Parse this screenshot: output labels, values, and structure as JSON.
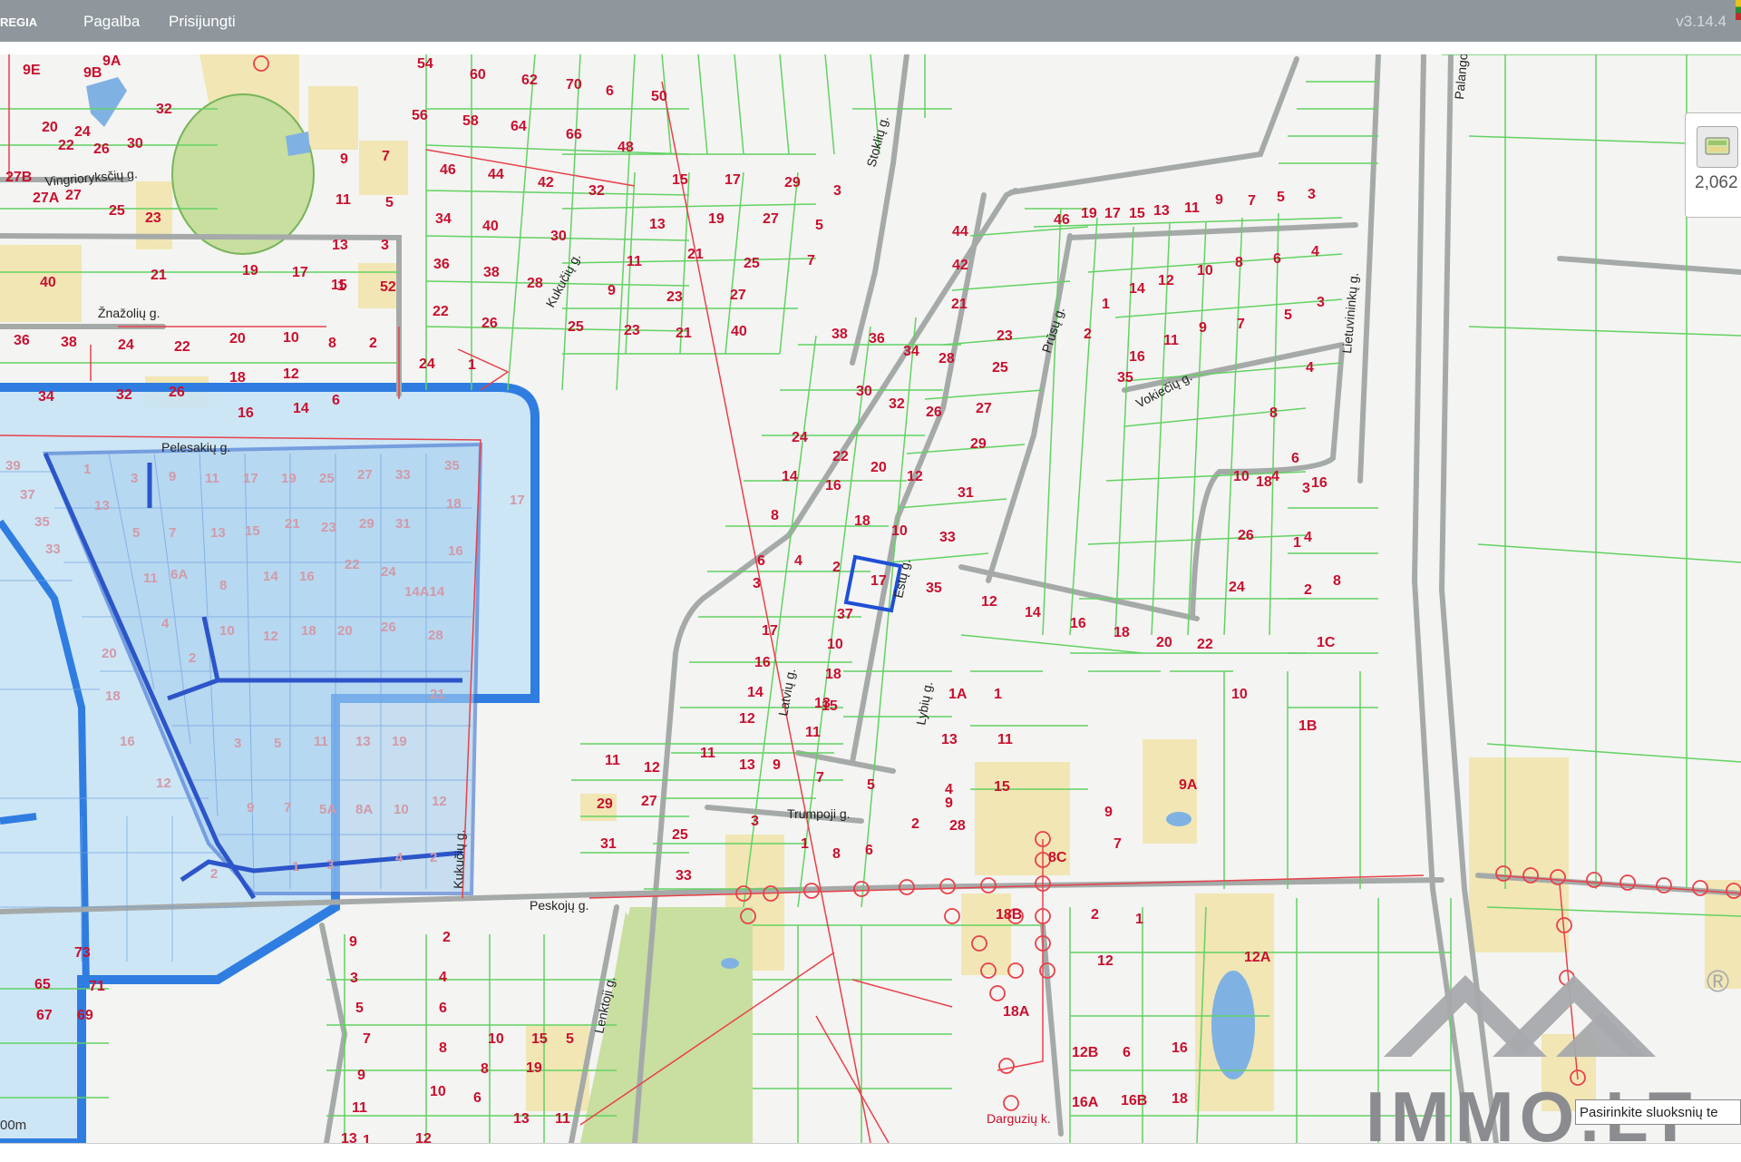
{
  "app": {
    "brand": "REGIA",
    "nav": [
      "Pagalba",
      "Prisijungti"
    ],
    "version": "v3.14.4"
  },
  "widget": {
    "value": "2,062",
    "icon": "layers-icon"
  },
  "scale_label": "00m",
  "tooltip": "Pasirinkite sluoksnių te",
  "watermark": {
    "text": "IMMO.LT",
    "mark": "®"
  },
  "colors": {
    "parcel": "#62d262",
    "number": "#c8102e",
    "road": "#a5aaa9",
    "zone_fill": "#bfe0f7",
    "zone_border": "#2f7de1",
    "highlight": "#1f4fd6",
    "building_fill": "#f2e8b8",
    "forest": "#c8dfa0",
    "power_line": "#e8414a"
  },
  "streets": [
    "Vingrioryksčių g.",
    "Žnažolių g.",
    "Kukučių g.",
    "Stoklių g.",
    "Estų g.",
    "Prūsų g.",
    "Vokiečių g.",
    "Lietuvininkų g.",
    "Palangos",
    "Lybių g.",
    "Latvių g.",
    "Trumpoji g.",
    "Peskojų g.",
    "Lenktoji g.",
    "Kukučių g.",
    "Pelesakių g.",
    "Darguzių k."
  ],
  "parcels": [
    "9E",
    "9B",
    "9A",
    "32",
    "20",
    "24",
    "22",
    "26",
    "30",
    "27B",
    "27A",
    "27",
    "25",
    "23",
    "40",
    "21",
    "19",
    "17",
    "15",
    "36",
    "38",
    "24",
    "22",
    "20",
    "10",
    "8",
    "2",
    "34",
    "32",
    "26",
    "18",
    "12",
    "6",
    "16",
    "14",
    "9",
    "7",
    "11",
    "5",
    "13",
    "3",
    "1",
    "52",
    "54",
    "60",
    "62",
    "70",
    "6",
    "50",
    "56",
    "58",
    "64",
    "66",
    "48",
    "46",
    "44",
    "42",
    "32",
    "34",
    "40",
    "30",
    "36",
    "38",
    "28",
    "22",
    "26",
    "24",
    "1",
    "15",
    "17",
    "29",
    "3",
    "13",
    "19",
    "27",
    "5",
    "11",
    "21",
    "25",
    "7",
    "9",
    "23",
    "27",
    "25",
    "23",
    "21",
    "40",
    "38",
    "36",
    "34",
    "28",
    "30",
    "32",
    "26",
    "24",
    "22",
    "20",
    "12",
    "14",
    "16",
    "18",
    "10",
    "8",
    "6",
    "4",
    "2",
    "17",
    "37",
    "35",
    "33",
    "31",
    "29",
    "27",
    "25",
    "23",
    "21",
    "42",
    "44",
    "46",
    "19",
    "17",
    "15",
    "13",
    "11",
    "9",
    "7",
    "5",
    "3",
    "1",
    "14",
    "12",
    "10",
    "8",
    "6",
    "4",
    "2",
    "16",
    "11",
    "9",
    "7",
    "5",
    "3",
    "1",
    "35",
    "18",
    "16",
    "4",
    "2",
    "1C",
    "1B",
    "1A",
    "1",
    "13",
    "11",
    "15",
    "9",
    "7",
    "9A",
    "9",
    "10",
    "8",
    "4",
    "3",
    "26",
    "24",
    "22",
    "20",
    "18",
    "16",
    "14",
    "12",
    "10",
    "8",
    "6",
    "4",
    "2",
    "1",
    "12",
    "12A",
    "12B",
    "6",
    "16",
    "16A",
    "16B",
    "18",
    "18A",
    "18B",
    "8C",
    "28",
    "11",
    "12",
    "29",
    "27",
    "31",
    "25",
    "33",
    "11",
    "13",
    "9",
    "7",
    "5",
    "3",
    "1",
    "8",
    "6",
    "4",
    "2",
    "3",
    "17",
    "16",
    "14",
    "12",
    "10",
    "18",
    "15",
    "13",
    "11",
    "9",
    "2",
    "4",
    "6",
    "8",
    "10",
    "12",
    "3",
    "5",
    "7",
    "9",
    "11",
    "13",
    "10",
    "8",
    "6",
    "15",
    "19",
    "5",
    "11",
    "13",
    "1",
    "73",
    "65",
    "67",
    "69",
    "71"
  ],
  "zone_numbers": [
    "39",
    "37",
    "35",
    "33",
    "1",
    "3",
    "9",
    "11",
    "17",
    "19",
    "25",
    "27",
    "33",
    "35",
    "13",
    "5",
    "7",
    "13",
    "15",
    "21",
    "23",
    "29",
    "31",
    "18",
    "17",
    "16",
    "11",
    "6A",
    "8",
    "14",
    "16",
    "22",
    "24",
    "14A14",
    "4",
    "10",
    "12",
    "18",
    "20",
    "26",
    "28",
    "2",
    "20",
    "18",
    "16",
    "12",
    "3",
    "5",
    "11",
    "13",
    "19",
    "21",
    "9",
    "7",
    "5A",
    "8A",
    "10",
    "12",
    "1",
    "3",
    "2",
    "4",
    "2"
  ]
}
